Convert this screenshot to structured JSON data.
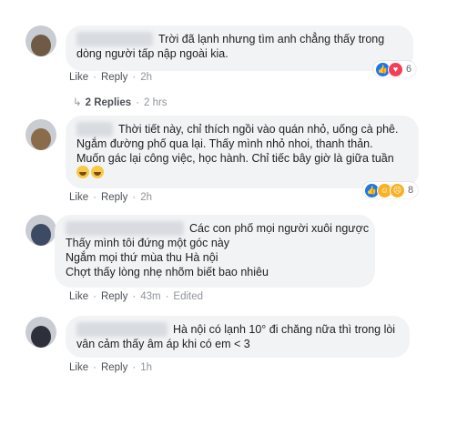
{
  "comments": [
    {
      "lines": [
        "Trời đã lạnh nhưng tìm anh chẳng thấy trong",
        "dòng người tấp nập ngoài kia."
      ],
      "like": "Like",
      "reply": "Reply",
      "time": "2h",
      "reaction_count": "6",
      "reaction_icons": [
        "like-icon",
        "love-icon"
      ],
      "replies_text": "2 Replies",
      "replies_time": "2 hrs"
    },
    {
      "lines": [
        "Thời tiết này, chỉ thích ngồi vào quán nhỏ, uống cà phê.",
        "Ngắm đường phố qua lại. Thấy mình nhỏ nhoi, thanh thản.",
        "Muốn gác lại công việc, học hành. Chỉ tiếc bây giờ là giữa tuần"
      ],
      "emoji_line": "laughing-emoji x2",
      "like": "Like",
      "reply": "Reply",
      "time": "2h",
      "reaction_count": "8",
      "reaction_icons": [
        "like-icon",
        "haha-icon",
        "sad-icon"
      ]
    },
    {
      "lines": [
        "Các con phố mọi người xuôi ngược",
        "Thấy mình tôi đứng một góc này",
        "Ngắm mọi thứ mùa thu Hà nội",
        "Chợt thấy lòng nhẹ nhõm biết bao nhiêu"
      ],
      "like": "Like",
      "reply": "Reply",
      "time": "43m",
      "edited": "Edited"
    },
    {
      "lines": [
        "Hà nội có lạnh 10° đi chăng nữa thì trong lòi",
        "vân cảm thấy âm áp khi có em < 3"
      ],
      "like": "Like",
      "reply": "Reply",
      "time": "1h"
    }
  ],
  "colors": {
    "bubble": "#f2f3f5",
    "text": "#1c1e21",
    "meta": "#606770",
    "like_blue": "#1877f2",
    "love_red": "#f33e58",
    "haha_yellow": "#f7b125"
  }
}
